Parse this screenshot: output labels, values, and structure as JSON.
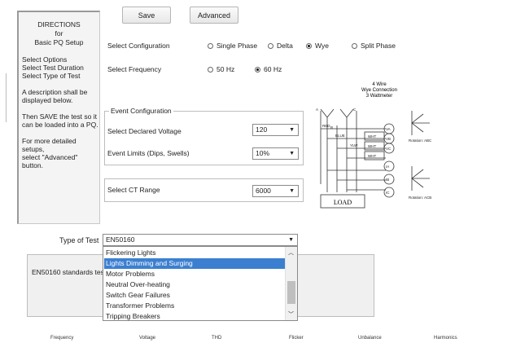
{
  "toolbar": {
    "save_label": "Save",
    "advanced_label": "Advanced"
  },
  "directions": {
    "title": [
      "DIRECTIONS",
      "for",
      "Basic PQ Setup"
    ],
    "text": "Select Options\nSelect Test Duration\nSelect Type of Test\n\nA description shall be displayed below.\n\nThen SAVE the test so it can be loaded into a PQ.\n\nFor more detailed setups,\nselect \"Advanced\" button."
  },
  "configuration": {
    "label": "Select Configuration",
    "options": [
      "Single Phase",
      "Delta",
      "Wye",
      "Split Phase"
    ],
    "selected": "Wye"
  },
  "frequency": {
    "label": "Select Frequency",
    "options": [
      "50 Hz",
      "60 Hz"
    ],
    "selected": "60 Hz"
  },
  "event_config": {
    "title": "Event Configuration",
    "voltage_label": "Select Declared Voltage",
    "voltage_value": "120",
    "limits_label": "Event Limits (Dips, Swells)",
    "limits_value": "10%"
  },
  "ct_range": {
    "label": "Select CT Range",
    "value": "6000"
  },
  "diagram": {
    "title_lines": [
      "4 Wire",
      "Wye Connection",
      "3 Wattmeter"
    ],
    "wire_labels": [
      "RED",
      "BLUE",
      "YLW",
      "WHT",
      "WHT",
      "WHT"
    ],
    "terminal_labels": [
      "A",
      "B",
      "C"
    ],
    "meter_labels": [
      "VA",
      "VB",
      "VC",
      "IA",
      "IB",
      "IC"
    ],
    "load_label": "LOAD",
    "rotation_labels": [
      "Rotation: ABC",
      "Rotation: ACB"
    ]
  },
  "test_type": {
    "label": "Type of Test",
    "value": "EN50160",
    "description": "EN50160 standards tes",
    "options": [
      "Flickering Lights",
      "Lights Dimming and Surging",
      "Motor Problems",
      "Neutral Over-heating",
      "Switch Gear Failures",
      "Transformer Problems",
      "Tripping Breakers"
    ],
    "highlighted": "Lights Dimming and Surging"
  },
  "bottom_tabs": [
    "Frequency",
    "Voltage",
    "THD",
    "Flicker",
    "Unbalance",
    "Harmonics"
  ],
  "colors": {
    "highlight": "#3c7fd0",
    "panel_bg": "#f4f4f4"
  }
}
